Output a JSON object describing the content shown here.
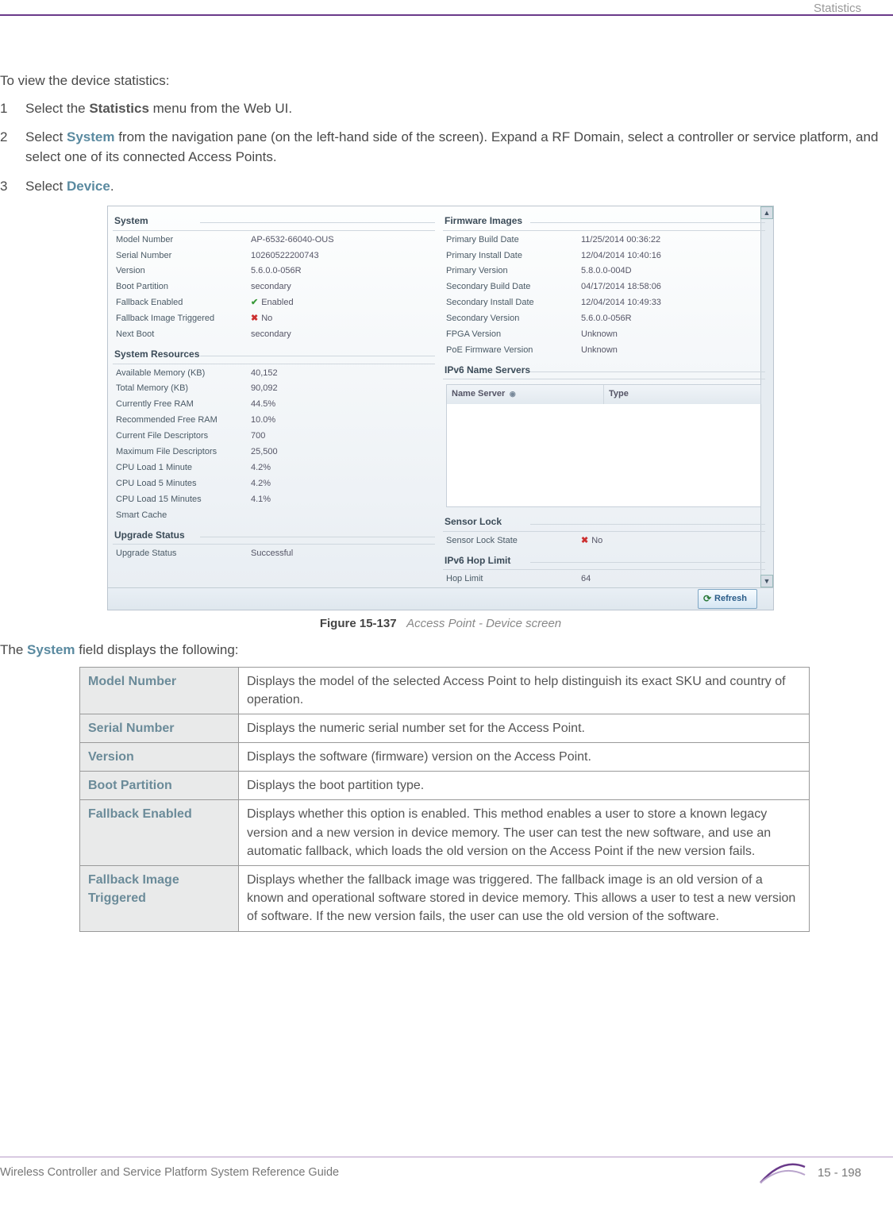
{
  "header": {
    "section": "Statistics"
  },
  "intro": "To view the device statistics:",
  "steps": {
    "s1_pre": "Select the ",
    "s1_bold": "Statistics",
    "s1_post": " menu from the Web UI.",
    "s2_pre": "Select ",
    "s2_bold": "System",
    "s2_post": " from the navigation pane (on the left-hand side of the screen). Expand a RF Domain, select a controller or service platform, and select one of its connected Access Points.",
    "s3_pre": "Select ",
    "s3_bold": "Device",
    "s3_post": "."
  },
  "screenshot": {
    "groups": {
      "system": {
        "title": "System",
        "rows": [
          {
            "k": "Model Number",
            "v": "AP-6532-66040-OUS"
          },
          {
            "k": "Serial Number",
            "v": "10260522200743"
          },
          {
            "k": "Version",
            "v": "5.6.0.0-056R"
          },
          {
            "k": "Boot Partition",
            "v": "secondary"
          },
          {
            "k": "Fallback Enabled",
            "v": "Enabled",
            "icon": "check"
          },
          {
            "k": "Fallback Image Triggered",
            "v": "No",
            "icon": "x"
          },
          {
            "k": "Next Boot",
            "v": "secondary"
          }
        ]
      },
      "resources": {
        "title": "System Resources",
        "rows": [
          {
            "k": "Available Memory (KB)",
            "v": "40,152"
          },
          {
            "k": "Total Memory (KB)",
            "v": "90,092"
          },
          {
            "k": "Currently Free RAM",
            "v": "44.5%"
          },
          {
            "k": "Recommended Free RAM",
            "v": "10.0%"
          },
          {
            "k": "Current File Descriptors",
            "v": "700"
          },
          {
            "k": "Maximum File Descriptors",
            "v": "25,500"
          },
          {
            "k": "CPU Load 1 Minute",
            "v": "4.2%"
          },
          {
            "k": "CPU Load 5 Minutes",
            "v": "4.2%"
          },
          {
            "k": "CPU Load 15 Minutes",
            "v": "4.1%"
          },
          {
            "k": "Smart Cache",
            "v": ""
          }
        ]
      },
      "upgrade": {
        "title": "Upgrade Status",
        "rows": [
          {
            "k": "Upgrade Status",
            "v": "Successful"
          }
        ]
      },
      "firmware": {
        "title": "Firmware Images",
        "rows": [
          {
            "k": "Primary Build Date",
            "v": "11/25/2014 00:36:22"
          },
          {
            "k": "Primary Install Date",
            "v": "12/04/2014 10:40:16"
          },
          {
            "k": "Primary Version",
            "v": "5.8.0.0-004D"
          },
          {
            "k": "Secondary Build Date",
            "v": "04/17/2014 18:58:06"
          },
          {
            "k": "Secondary Install Date",
            "v": "12/04/2014 10:49:33"
          },
          {
            "k": "Secondary Version",
            "v": "5.6.0.0-056R"
          },
          {
            "k": "FPGA Version",
            "v": "Unknown"
          },
          {
            "k": "PoE Firmware Version",
            "v": "Unknown"
          }
        ]
      },
      "ipv6ns": {
        "title": "IPv6 Name Servers",
        "col1": "Name Server",
        "col2": "Type"
      },
      "sensor": {
        "title": "Sensor Lock",
        "rows": [
          {
            "k": "Sensor Lock State",
            "v": "No",
            "icon": "x"
          }
        ]
      },
      "hop": {
        "title": "IPv6 Hop Limit",
        "rows": [
          {
            "k": "Hop Limit",
            "v": "64"
          }
        ]
      }
    },
    "refresh": "Refresh"
  },
  "caption": {
    "fig": "Figure 15-137",
    "title": "Access Point - Device screen"
  },
  "system_note_pre": "The ",
  "system_note_bold": "System",
  "system_note_post": " field displays the following:",
  "desc_table": [
    {
      "key": "Model Number",
      "val": "Displays the model of the selected Access Point to help distinguish its exact SKU and country of operation."
    },
    {
      "key": "Serial Number",
      "val": "Displays the numeric serial number set for the Access Point."
    },
    {
      "key": "Version",
      "val": "Displays the software (firmware) version on the Access Point."
    },
    {
      "key": "Boot Partition",
      "val": "Displays the boot partition type."
    },
    {
      "key": "Fallback Enabled",
      "val": "Displays whether this option is enabled. This method enables a user to store a known legacy version and a new version in device memory. The user can test the new software, and use an automatic fallback, which loads the old version on the Access Point if the new version fails."
    },
    {
      "key": "Fallback Image Triggered",
      "val": "Displays whether the fallback image was triggered. The fallback image is an old version of a known and operational software stored in device memory. This allows a user to test a new version of software. If the new version fails, the user can use the old version of the software."
    }
  ],
  "footer": {
    "text": "Wireless Controller and Service Platform System Reference Guide",
    "page": "15 - 198"
  }
}
